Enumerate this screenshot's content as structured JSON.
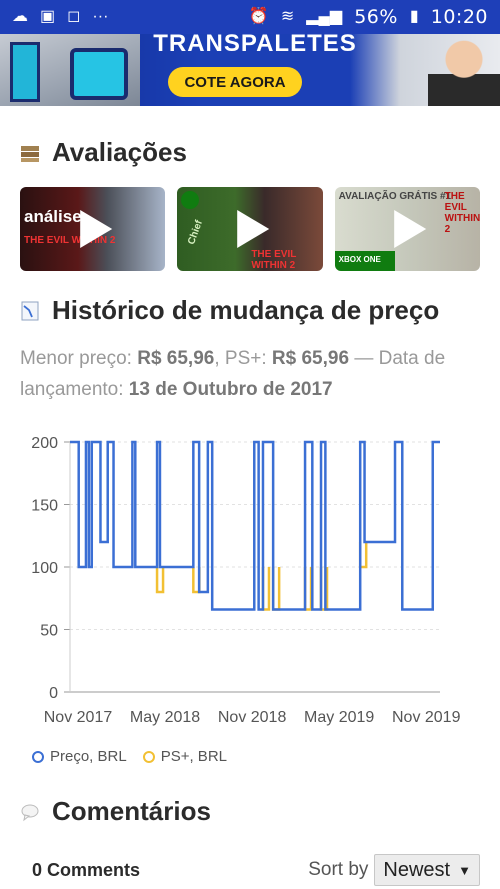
{
  "status_bar": {
    "icons_left": [
      "cloud-icon",
      "android-icon",
      "instagram-icon",
      "more-dots-icon"
    ],
    "icons_right": [
      "alarm-icon",
      "wifi-icon",
      "signal-icon",
      "battery-icon"
    ],
    "battery": "56%",
    "time": "10:20"
  },
  "banner": {
    "title": "TRANSPALETES",
    "cta": "COTE AGORA"
  },
  "reviews": {
    "title": "Avaliações",
    "videos": [
      {
        "caption": "análise",
        "subtitle": "THE EVIL WITHIN 2"
      },
      {
        "caption": "Chief",
        "subtitle": "THE EVIL WITHIN 2"
      },
      {
        "caption": "AVALIAÇÃO GRÁTIS #1",
        "subtitle": "THE EVIL WITHIN 2",
        "platform": "XBOX ONE"
      }
    ]
  },
  "price_history": {
    "title": "Histórico de mudança de preço",
    "lowest_label": "Menor preço:",
    "lowest_value": "R$ 65,96",
    "psplus_label": ", PS+:",
    "psplus_value": "R$ 65,96",
    "release_label": "— Data de lançamento:",
    "release_value": "13 de Outubro de 2017"
  },
  "chart_data": {
    "type": "line",
    "step": true,
    "x_ticks": [
      "Nov 2017",
      "May 2018",
      "Nov 2018",
      "May 2019",
      "Nov 2019"
    ],
    "y_ticks": [
      "200",
      "150",
      "100",
      "50",
      "0"
    ],
    "ylim": [
      0,
      200
    ],
    "xlim_months": [
      0,
      25
    ],
    "series": [
      {
        "name": "Preço, BRL",
        "color": "#3b6fd4",
        "x": [
          0,
          0.6,
          0.6,
          1.1,
          1.1,
          1.3,
          1.3,
          1.5,
          1.5,
          2.1,
          2.1,
          2.6,
          2.6,
          3.0,
          3.0,
          4.3,
          4.3,
          4.5,
          4.5,
          6.0,
          6.0,
          6.2,
          6.2,
          8.5,
          8.5,
          8.9,
          8.9,
          9.5,
          9.5,
          9.8,
          9.8,
          12.7,
          12.7,
          13.0,
          13.0,
          13.3,
          13.3,
          14.0,
          14.0,
          16.2,
          16.2,
          16.7,
          16.7,
          17.3,
          17.3,
          17.6,
          17.6,
          20.0,
          20.0,
          20.3,
          20.3,
          22.4,
          22.4,
          22.9,
          22.9,
          25.0,
          25.0,
          25.5
        ],
        "y": [
          200,
          200,
          100,
          100,
          200,
          200,
          100,
          100,
          200,
          200,
          120,
          120,
          200,
          200,
          100,
          100,
          200,
          200,
          100,
          100,
          200,
          200,
          100,
          100,
          200,
          200,
          80,
          80,
          200,
          200,
          66,
          66,
          200,
          200,
          66,
          66,
          200,
          200,
          66,
          66,
          200,
          200,
          66,
          66,
          200,
          200,
          66,
          66,
          200,
          200,
          120,
          120,
          200,
          200,
          66,
          66,
          200,
          200
        ]
      },
      {
        "name": "PS+, BRL",
        "color": "#f2c033",
        "segments": [
          [
            6.0,
            100,
            80
          ],
          [
            8.5,
            100,
            80
          ],
          [
            13.3,
            100,
            66
          ],
          [
            14.0,
            100,
            66
          ],
          [
            16.2,
            100,
            66
          ],
          [
            17.3,
            100,
            66
          ],
          [
            20.0,
            120,
            100
          ]
        ]
      }
    ],
    "grid": true,
    "legend_position": "bottom-left"
  },
  "comments": {
    "title": "Comentários",
    "count": "0 Comments",
    "sort_label": "Sort by",
    "sort_value": "Newest"
  }
}
